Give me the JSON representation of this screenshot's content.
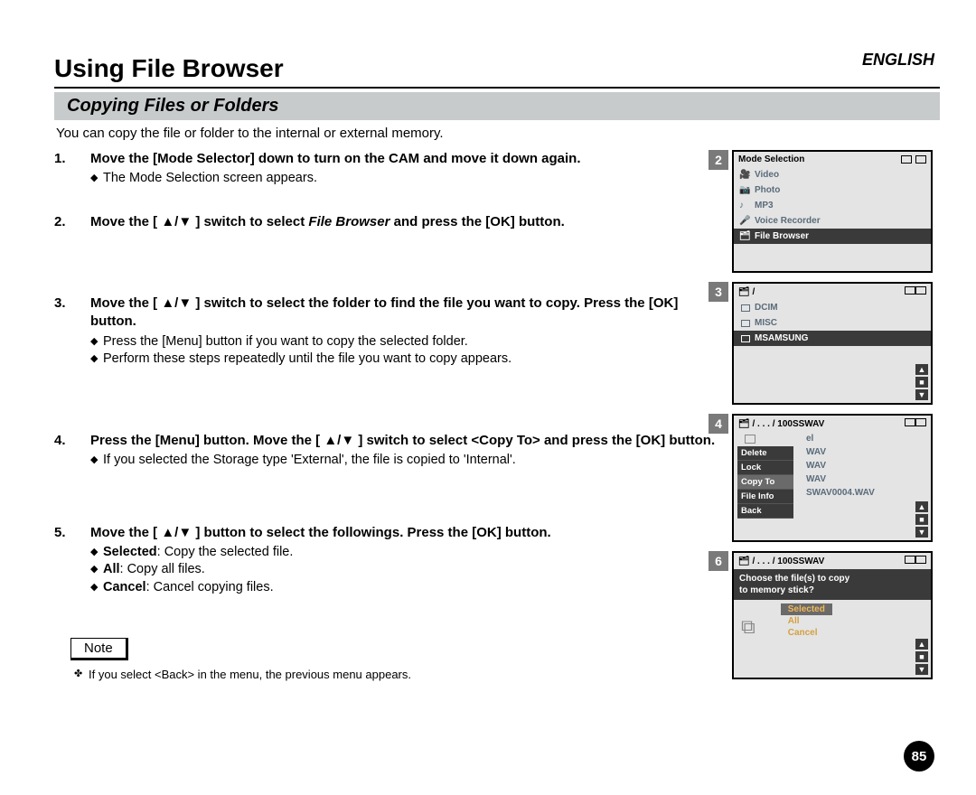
{
  "language": "ENGLISH",
  "chapter_title": "Using File Browser",
  "section_title": "Copying Files or Folders",
  "intro": "You can copy the file or folder to the internal or external memory.",
  "steps": [
    {
      "head_parts": [
        "Move the [Mode Selector] down to turn on the CAM and move it down again."
      ],
      "subs": [
        "The Mode Selection screen appears."
      ]
    },
    {
      "head_parts": [
        "Move the [ ▲/▼ ] switch to select ",
        {
          "ital": "File Browser"
        },
        " and press the [OK] button."
      ],
      "subs": []
    },
    {
      "head_parts": [
        "Move the [ ▲/▼ ] switch to select the folder to find the file you want to copy. Press the [OK] button."
      ],
      "subs": [
        "Press the [Menu] button if you want to copy the selected folder.",
        "Perform these steps repeatedly until the file you want to copy appears."
      ]
    },
    {
      "head_parts": [
        "Press the [Menu] button. Move the [ ▲/▼ ] switch to select <Copy To> and press the [OK] button."
      ],
      "subs": [
        "If you selected the Storage type 'External', the file is copied to 'Internal'."
      ]
    },
    {
      "head_parts": [
        "Move the [ ▲/▼ ] button to select the followings. Press the [OK] button."
      ],
      "subs_kv": [
        {
          "k": "Selected",
          "v": ": Copy the selected file."
        },
        {
          "k": "All",
          "v": ": Copy all files."
        },
        {
          "k": "Cancel",
          "v": ": Cancel copying files."
        }
      ]
    }
  ],
  "note_label": "Note",
  "note_text": "If you select <Back> in the menu, the previous menu appears.",
  "page_number": "85",
  "screens": {
    "s2": {
      "num": "2",
      "title": "Mode Selection",
      "items": [
        {
          "icon": "video",
          "label": "Video"
        },
        {
          "icon": "photo",
          "label": "Photo"
        },
        {
          "icon": "mp3",
          "label": "MP3"
        },
        {
          "icon": "voice",
          "label": "Voice Recorder"
        },
        {
          "icon": "file",
          "label": "File Browser",
          "sel": true
        }
      ]
    },
    "s3": {
      "num": "3",
      "bread": "/",
      "folders": [
        {
          "label": "DCIM"
        },
        {
          "label": "MISC"
        },
        {
          "label": "MSAMSUNG",
          "sel": true
        }
      ]
    },
    "s4": {
      "num": "4",
      "bread": "/ . . . / 100SSWAV",
      "menu": [
        "Delete",
        "Lock",
        "Copy To",
        "File Info",
        "Back"
      ],
      "menu_sel": "Copy To",
      "files_bg": [
        "el",
        "WAV",
        "WAV",
        "WAV",
        "SWAV0004.WAV"
      ]
    },
    "s6": {
      "num": "6",
      "bread": "/ . . . / 100SSWAV",
      "prompt_l1": "Choose the file(s) to copy",
      "prompt_l2": "to memory stick?",
      "options": [
        "Selected",
        "All",
        "Cancel"
      ],
      "opt_sel": "Selected"
    }
  }
}
